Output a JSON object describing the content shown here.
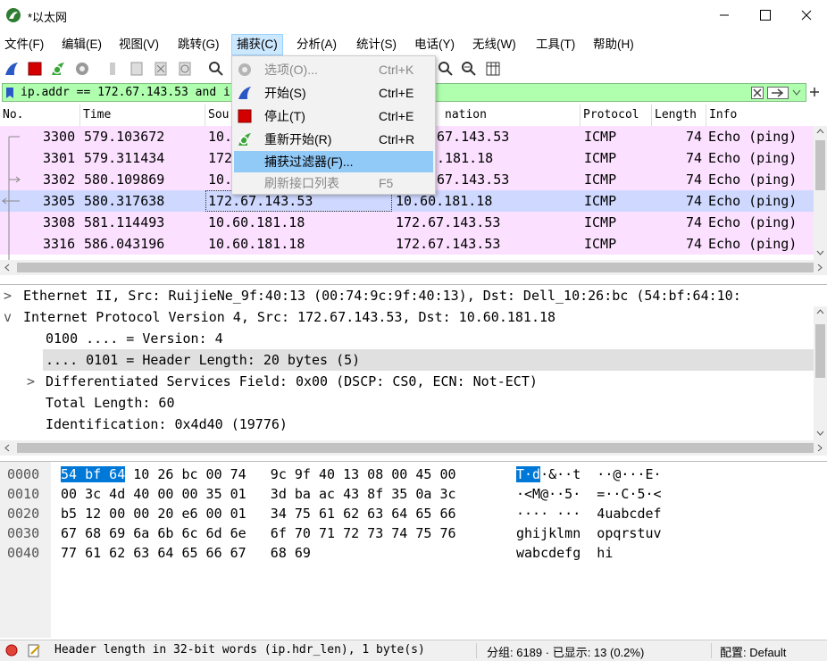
{
  "window": {
    "title": "*以太网",
    "controls": {
      "minimize": "minimize-icon",
      "maximize": "maximize-icon",
      "close": "close-icon"
    }
  },
  "menubar": {
    "items": [
      "文件(F)",
      "编辑(E)",
      "视图(V)",
      "跳转(G)",
      "捕获(C)",
      "分析(A)",
      "统计(S)",
      "电话(Y)",
      "无线(W)",
      "工具(T)",
      "帮助(H)"
    ],
    "active": "捕获(C)"
  },
  "capture_menu": {
    "items": [
      {
        "label": "选项(O)...",
        "shortcut": "Ctrl+K",
        "icon": "gear-icon",
        "disabled": true
      },
      {
        "label": "开始(S)",
        "shortcut": "Ctrl+E",
        "icon": "shark-fin-icon",
        "disabled": false
      },
      {
        "label": "停止(T)",
        "shortcut": "Ctrl+E",
        "icon": "stop-icon",
        "disabled": false
      },
      {
        "label": "重新开始(R)",
        "shortcut": "Ctrl+R",
        "icon": "restart-icon",
        "disabled": false
      },
      {
        "label": "捕获过滤器(F)...",
        "shortcut": "",
        "icon": "",
        "disabled": false,
        "hover": true
      },
      {
        "label": "刷新接口列表",
        "shortcut": "F5",
        "icon": "",
        "disabled": true
      }
    ]
  },
  "filter": {
    "value": "ip.addr == 172.67.143.53 and i",
    "color": "#afffaf"
  },
  "packet_list": {
    "columns": [
      "No.",
      "Time",
      "Sou",
      "nation",
      "Protocol",
      "Length",
      "Info"
    ],
    "rows": [
      {
        "no": "3300",
        "time": "579.103672",
        "source": "10.",
        "destination": "67.143.53",
        "protocol": "ICMP",
        "length": "74",
        "info": "Echo (ping)"
      },
      {
        "no": "3301",
        "time": "579.311434",
        "source": "172",
        ".destination_note": "",
        "destination": ".181.18",
        "protocol": "ICMP",
        "length": "74",
        "info": "Echo (ping)"
      },
      {
        "no": "3302",
        "time": "580.109869",
        "source": "10.",
        "destination": "67.143.53",
        "protocol": "ICMP",
        "length": "74",
        "info": "Echo (ping)"
      },
      {
        "no": "3305",
        "time": "580.317638",
        "source": "172.67.143.53",
        "destination": "10.60.181.18",
        "protocol": "ICMP",
        "length": "74",
        "info": "Echo (ping)",
        "selected": true
      },
      {
        "no": "3308",
        "time": "581.114493",
        "source": "10.60.181.18",
        "destination": "172.67.143.53",
        "protocol": "ICMP",
        "length": "74",
        "info": "Echo (ping)"
      },
      {
        "no": "3316",
        "time": "586.043196",
        "source": "10.60.181.18",
        "destination": "172.67.143.53",
        "protocol": "ICMP",
        "length": "74",
        "info": "Echo (ping)"
      }
    ],
    "row_color": "#fce0ff",
    "selected_color": "#cfd9ff"
  },
  "details": {
    "lines": [
      {
        "text": "Ethernet II, Src: RuijieNe_9f:40:13 (00:74:9c:9f:40:13), Dst: Dell_10:26:bc (54:bf:64:10:",
        "expander": ">"
      },
      {
        "text": "Internet Protocol Version 4, Src: 172.67.143.53, Dst: 10.60.181.18",
        "expander": "v"
      },
      {
        "text": "0100 .... = Version: 4",
        "expander": ""
      },
      {
        "text": ".... 0101 = Header Length: 20 bytes (5)",
        "expander": "",
        "highlight": true
      },
      {
        "text": "Differentiated Services Field: 0x00 (DSCP: CS0, ECN: Not-ECT)",
        "expander": ">"
      },
      {
        "text": "Total Length: 60",
        "expander": ""
      },
      {
        "text": "Identification: 0x4d40 (19776)",
        "expander": ""
      }
    ]
  },
  "bytes": {
    "lines": [
      {
        "offset": "0000",
        "sel_hex": "54 bf 64",
        "hex": " 10 26 bc 00 74   9c 9f 40 13 08 00 45 00",
        "sel_ascii": "T·d",
        "ascii": "·&··t  ··@···E·"
      },
      {
        "offset": "0010",
        "sel_hex": "",
        "hex": "00 3c 4d 40 00 00 35 01   3d ba ac 43 8f 35 0a 3c",
        "sel_ascii": "",
        "ascii": "·<M@··5·  =··C·5·<"
      },
      {
        "offset": "0020",
        "sel_hex": "",
        "hex": "b5 12 00 00 20 e6 00 01   34 75 61 62 63 64 65 66",
        "sel_ascii": "",
        "ascii": "···· ···  4uabcdef"
      },
      {
        "offset": "0030",
        "sel_hex": "",
        "hex": "67 68 69 6a 6b 6c 6d 6e   6f 70 71 72 73 74 75 76",
        "sel_ascii": "",
        "ascii": "ghijklmn  opqrstuv"
      },
      {
        "offset": "0040",
        "sel_hex": "",
        "hex": "77 61 62 63 64 65 66 67   68 69",
        "sel_ascii": "",
        "ascii": "wabcdefg  hi"
      }
    ]
  },
  "statusbar": {
    "field_info": "Header length in 32-bit words (ip.hdr_len), 1 byte(s)",
    "packets": "分组: 6189 · 已显示: 13 (0.2%)",
    "profile": "配置: Default"
  }
}
